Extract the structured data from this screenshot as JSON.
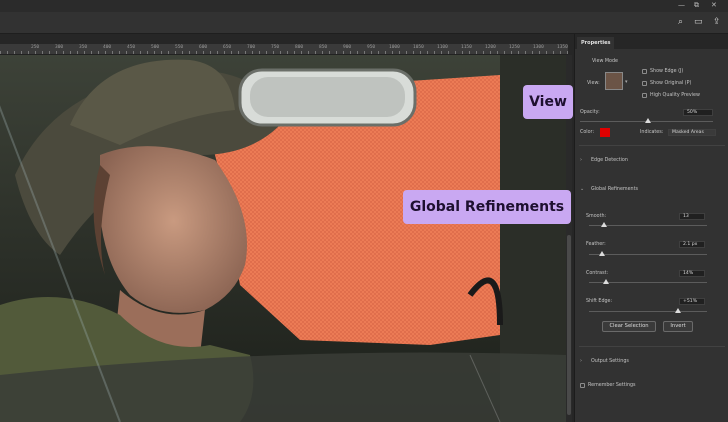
{
  "window": {
    "controls": [
      "—",
      "⧉",
      "✕"
    ]
  },
  "toolbar": {
    "icons": [
      "search-icon",
      "workspace-icon",
      "share-icon"
    ]
  },
  "ruler": {
    "ticks": [
      "250",
      "300",
      "350",
      "400",
      "450",
      "500",
      "550",
      "600",
      "650",
      "700",
      "750",
      "800",
      "850",
      "900",
      "950",
      "1000",
      "1050",
      "1100",
      "1150",
      "1200",
      "1250",
      "1300",
      "1350"
    ]
  },
  "panel": {
    "tab_label": "Properties",
    "view_mode": {
      "heading": "View Mode",
      "view_label": "View:",
      "show_edge": "Show Edge (J)",
      "show_original": "Show Original (P)",
      "high_quality": "High Quality Preview"
    },
    "opacity": {
      "label": "Opacity:",
      "value": "50%",
      "level": 0.5
    },
    "color": {
      "label": "Color:",
      "swatch": "#e00000",
      "indicates_label": "Indicates:",
      "indicates_value": "Masked Areas"
    },
    "edge_detection": {
      "label": "Edge Detection"
    },
    "global_refinements": {
      "label": "Global Refinements",
      "smooth": {
        "label": "Smooth:",
        "value": "13"
      },
      "feather": {
        "label": "Feather:",
        "value": "2.1 px"
      },
      "contrast": {
        "label": "Contrast:",
        "value": "14%"
      },
      "shift_edge": {
        "label": "Shift Edge:",
        "value": "+51%"
      }
    },
    "clear_selection": "Clear Selection",
    "invert": "Invert",
    "output_settings": "Output Settings",
    "remember_settings": "Remember Settings"
  },
  "callouts": {
    "view": "View",
    "global_refinements": "Global Refinements"
  },
  "colors": {
    "callout_bg": "#c9a8f2",
    "overlay": "#ec7b55",
    "panel_bg": "#323232"
  }
}
